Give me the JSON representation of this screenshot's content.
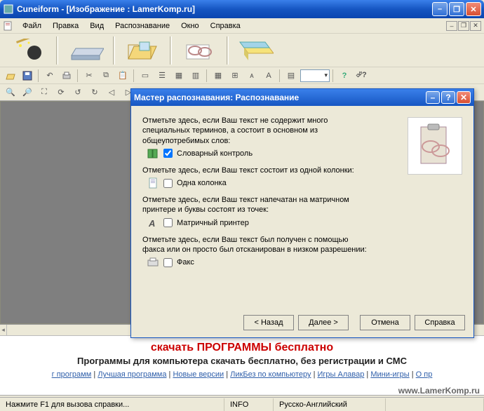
{
  "window": {
    "title": "Cuneiform - [Изображение : LamerKomp.ru]"
  },
  "menu": {
    "items": [
      "Файл",
      "Правка",
      "Вид",
      "Распознавание",
      "Окно",
      "Справка"
    ]
  },
  "toolbar_small": {
    "combo": ""
  },
  "dialog": {
    "title": "Мастер распознавания: Распознавание",
    "p1": "Отметьте здесь, если Ваш текст не содержит много специальных терминов, а состоит в основном из общеупотребимых слов:",
    "c1_label": "Словарный контроль",
    "c1_checked": true,
    "p2": "Отметьте здесь, если Ваш текст состоит из одной колонки:",
    "c2_label": "Одна колонка",
    "c2_checked": false,
    "p3": "Отметьте здесь, если Ваш текст напечатан на матричном принтере и буквы состоят из точек:",
    "c3_label": "Матричный принтер",
    "c3_checked": false,
    "p4": "Отметьте здесь, если Ваш текст был получен с помощью факса или он просто был отсканирован в низком разрешении:",
    "c4_label": "Факс",
    "c4_checked": false,
    "buttons": {
      "back": "< Назад",
      "next": "Далее >",
      "cancel": "Отмена",
      "help": "Справка"
    }
  },
  "page": {
    "headline": "скачать ПРОГРАММЫ бесплатно",
    "sub": "Программы для компьютера скачать бесплатно, без регистрации и СМС",
    "links": [
      "г программ",
      "Лучшая программа",
      "Новые версии",
      "ЛикБез по компьютеру",
      "Игры Алавар",
      "Мини-игры",
      "О пр"
    ]
  },
  "status": {
    "hint": "Нажмите F1 для вызова справки...",
    "info": "INFO",
    "lang": "Русско-Английский"
  },
  "watermark": "www.LamerKomp.ru"
}
